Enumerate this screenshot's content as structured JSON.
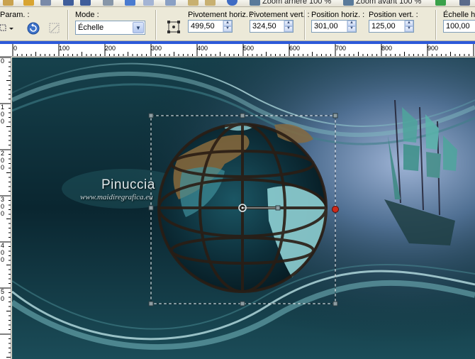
{
  "topbar": {
    "zoom_out_label": "Zoom arrière 100 %",
    "zoom_in_label": "Zoom avant 100 %"
  },
  "options": {
    "params_label": "Param. :",
    "mode_label": "Mode :",
    "mode_value": "Échelle",
    "rot_h_label": "Pivotement horiz. :",
    "rot_h_value": "499,50",
    "rot_v_label": "Pivotement vert. :",
    "rot_v_value": "324,50",
    "pos_h_label": "Position horiz. :",
    "pos_h_value": "301,00",
    "pos_v_label": "Position vert. :",
    "pos_v_value": "125,00",
    "scale_h_label": "Échelle horiz.",
    "scale_h_value": "100,00"
  },
  "ruler": {
    "top_labels": [
      "0",
      "100",
      "200",
      "300",
      "400",
      "500",
      "600",
      "700",
      "800",
      "900"
    ],
    "left_labels": [
      "0",
      "1 0 0",
      "2 0 0",
      "3 0 0",
      "4 0 0",
      "5 0"
    ]
  },
  "canvas": {
    "watermark_name": "Pinuccia",
    "watermark_site": "www.maidiregrafica.eu"
  },
  "colors": {
    "accent": "#2d59d9",
    "canvas_dark": "#0d2a33",
    "teal": "#3c8c92",
    "handle_red": "#cc2a1a"
  }
}
